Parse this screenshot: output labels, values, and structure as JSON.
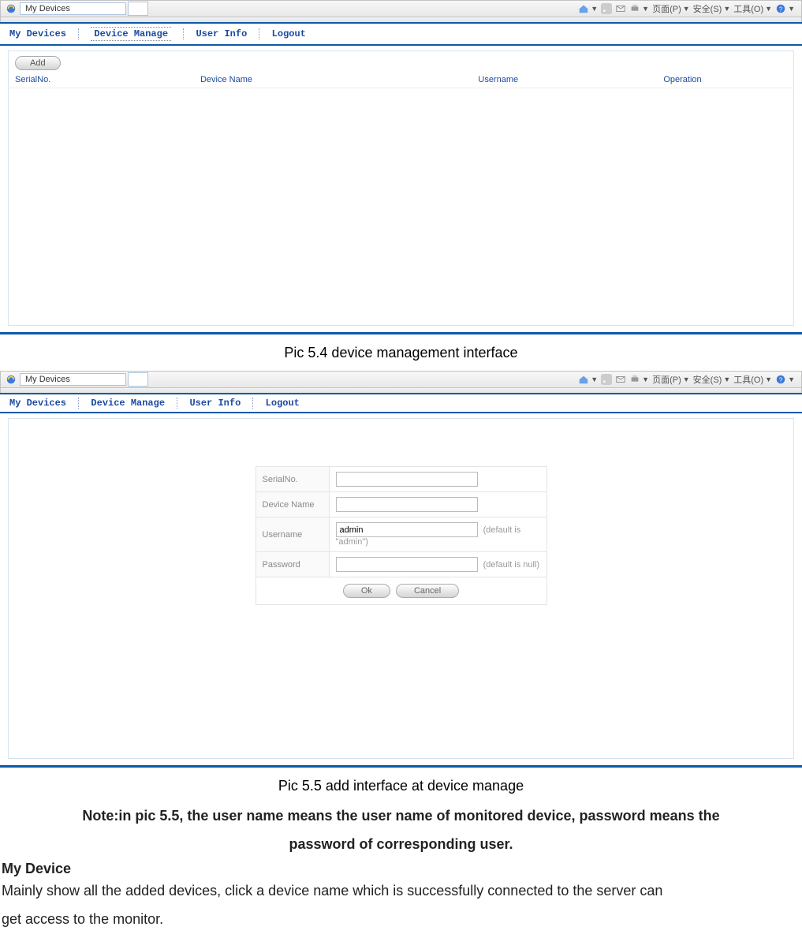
{
  "browser": {
    "tab_title": "My Devices",
    "toolbar": {
      "page_label": "页面(P)",
      "safety_label": "安全(S)",
      "tools_label": "工具(O)"
    }
  },
  "nav": {
    "my_devices": "My Devices",
    "device_manage": "Device Manage",
    "user_info": "User Info",
    "logout": "Logout"
  },
  "panel1": {
    "add_label": "Add",
    "col1": "SerialNo.",
    "col2": "Device Name",
    "col3": "Username",
    "col4": "Operation"
  },
  "caption1": "Pic 5.4 device management interface",
  "panel2": {
    "serial_label": "SerialNo.",
    "devicename_label": "Device Name",
    "username_label": "Username",
    "password_label": "Password",
    "username_value": "admin",
    "password_value": "",
    "serial_value": "",
    "devicename_value": "",
    "username_hint": "(default is \"admin\")",
    "password_hint": "(default is null)",
    "ok_label": "Ok",
    "cancel_label": "Cancel"
  },
  "caption2": "Pic 5.5 add interface at device manage",
  "note_line1": "Note:in pic 5.5, the user name means the user name of monitored device, password means the",
  "note_line2": "password of corresponding user.",
  "section_heading": "My Device",
  "body_line1": "Mainly show all the added devices, click a device name which is successfully connected to the server can",
  "body_line2": "get access to the monitor."
}
